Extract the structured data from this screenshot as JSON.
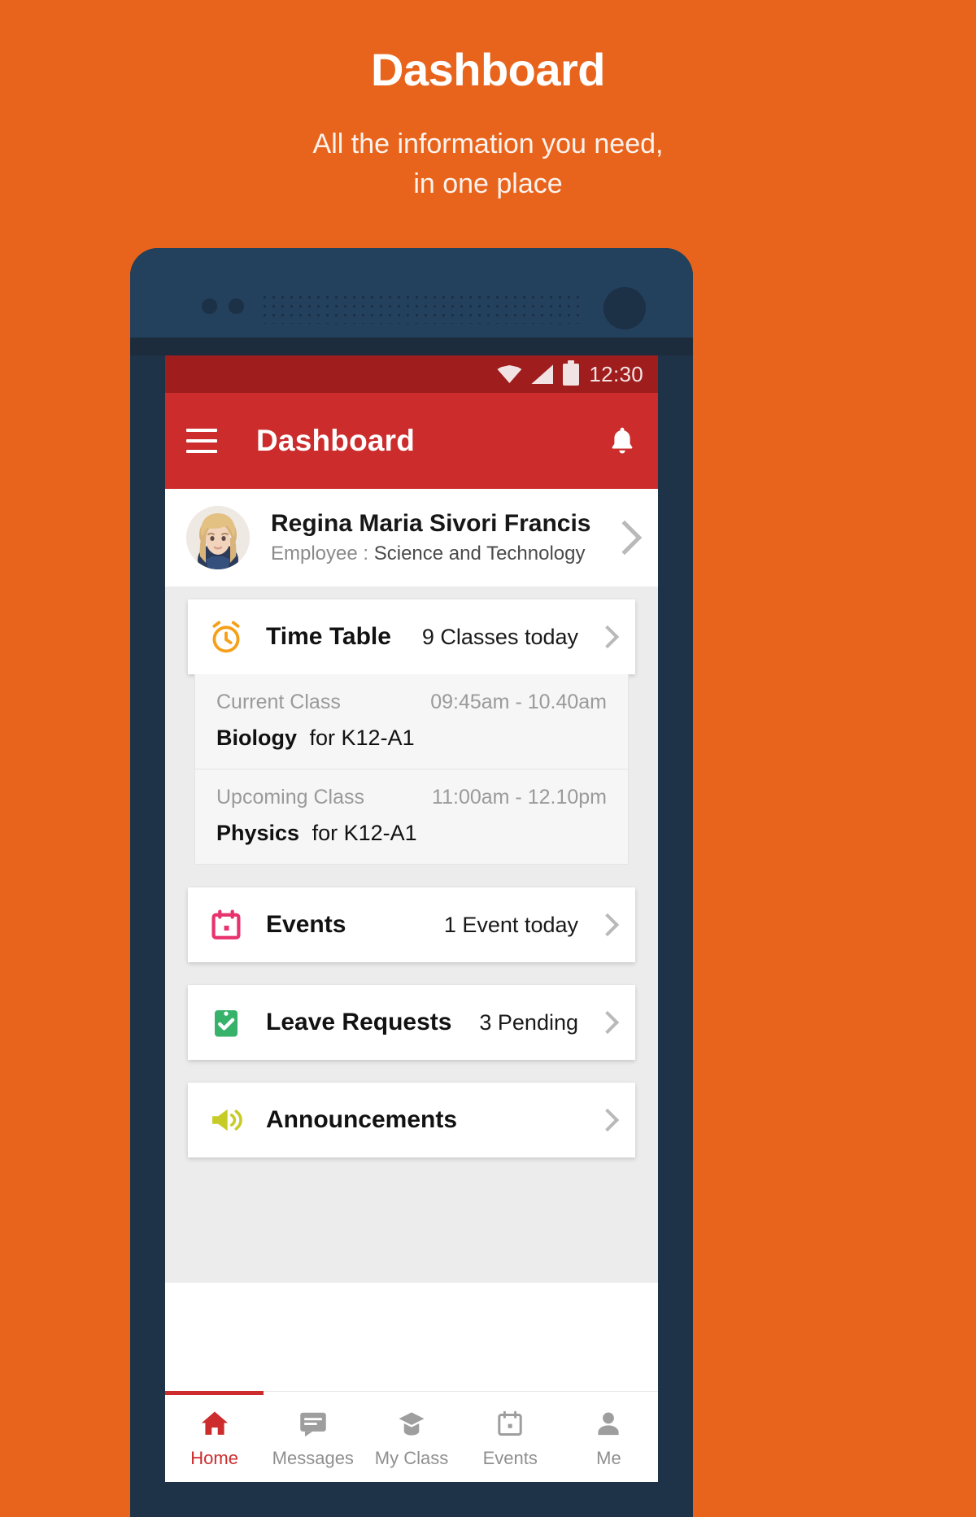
{
  "promo": {
    "title": "Dashboard",
    "subtitle_line1": "All the information you need,",
    "subtitle_line2": "in one place"
  },
  "statusbar": {
    "time": "12:30",
    "icons": [
      "wifi-icon",
      "signal-icon",
      "battery-icon"
    ]
  },
  "appbar": {
    "menu_icon": "hamburger-menu-icon",
    "title": "Dashboard",
    "notification_icon": "bell-icon"
  },
  "profile": {
    "avatar": "user-avatar",
    "name": "Regina Maria Sivori Francis",
    "role_label": "Employee :",
    "role_value": "Science and Technology",
    "chevron": "chevron-right-icon"
  },
  "cards": {
    "timetable": {
      "icon": "alarm-clock-icon",
      "icon_color": "#F6A019",
      "title": "Time Table",
      "meta": "9 Classes today",
      "chevron": "chevron-right-icon",
      "classes": [
        {
          "label": "Current Class",
          "time": "09:45am - 10.40am",
          "subject": "Biology",
          "section": "for K12-A1"
        },
        {
          "label": "Upcoming Class",
          "time": "11:00am - 12.10pm",
          "subject": "Physics",
          "section": "for K12-A1"
        }
      ]
    },
    "events": {
      "icon": "calendar-icon",
      "icon_color": "#E8336E",
      "title": "Events",
      "meta": "1 Event today",
      "chevron": "chevron-right-icon"
    },
    "leave_requests": {
      "icon": "clipboard-check-icon",
      "icon_color": "#36B26B",
      "title": "Leave Requests",
      "meta": "3 Pending",
      "chevron": "chevron-right-icon"
    },
    "announcements": {
      "icon": "megaphone-icon",
      "icon_color": "#C6CC25",
      "title": "Announcements",
      "meta": "",
      "chevron": "chevron-right-icon"
    }
  },
  "bottom_nav": {
    "items": [
      {
        "icon": "home-icon",
        "label": "Home",
        "active": true
      },
      {
        "icon": "message-icon",
        "label": "Messages",
        "active": false
      },
      {
        "icon": "myclass-icon",
        "label": "My Class",
        "active": false
      },
      {
        "icon": "calendar-icon",
        "label": "Events",
        "active": false
      },
      {
        "icon": "person-icon",
        "label": "Me",
        "active": false
      }
    ]
  },
  "colors": {
    "brand_orange": "#E8641C",
    "app_red": "#CC2C2C",
    "statusbar_red": "#9F1D1D",
    "phone_body": "#1E3348"
  }
}
